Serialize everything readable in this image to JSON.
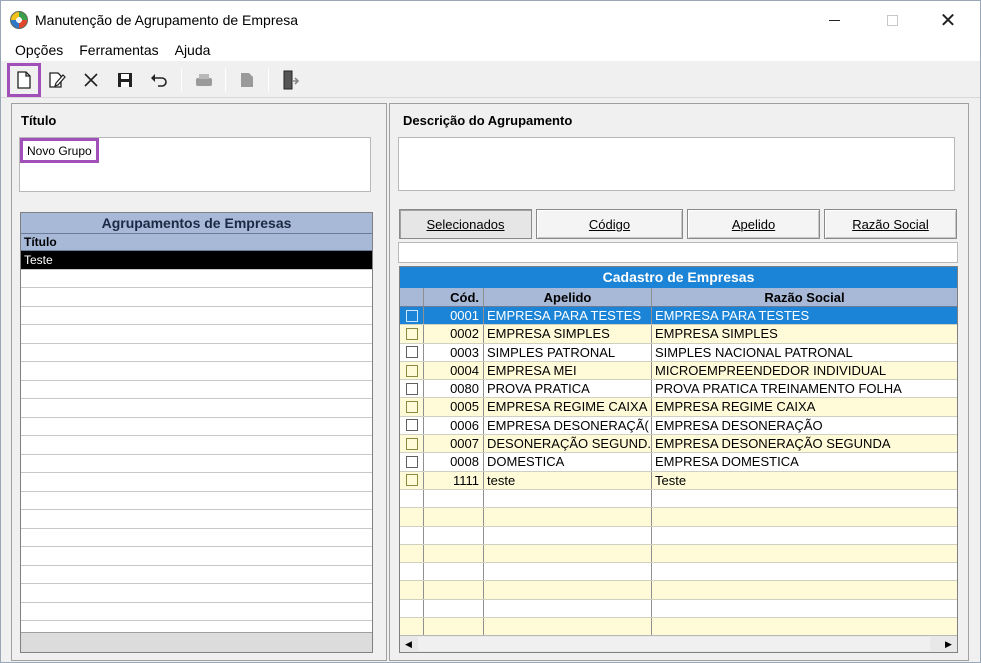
{
  "window": {
    "title": "Manutenção de Agrupamento de Empresa",
    "close_glyph": "✕"
  },
  "menu": [
    "Opções",
    "Ferramentas",
    "Ajuda"
  ],
  "toolbar": {
    "icons": [
      "new-document-icon",
      "edit-icon",
      "delete-icon",
      "save-icon",
      "undo-icon",
      "print-icon",
      "copy-icon",
      "exit-icon"
    ]
  },
  "left": {
    "titulo_label": "Título",
    "titulo_value": "Novo Grupo",
    "grid_title": "Agrupamentos de Empresas",
    "grid_column": "Título",
    "rows": [
      "Teste"
    ]
  },
  "right": {
    "descricao_label": "Descrição do Agrupamento",
    "descricao_value": "",
    "buttons": [
      "Selecionados",
      "Código",
      "Apelido",
      "Razão Social"
    ],
    "grid_title": "Cadastro de Empresas",
    "columns": [
      "",
      "Cód.",
      "Apelido",
      "Razão Social"
    ],
    "rows": [
      {
        "codigo": "0001",
        "apelido": "EMPRESA PARA TESTES",
        "razao": "EMPRESA PARA TESTES"
      },
      {
        "codigo": "0002",
        "apelido": "EMPRESA SIMPLES",
        "razao": "EMPRESA SIMPLES"
      },
      {
        "codigo": "0003",
        "apelido": "SIMPLES PATRONAL",
        "razao": "SIMPLES NACIONAL PATRONAL"
      },
      {
        "codigo": "0004",
        "apelido": "EMPRESA MEI",
        "razao": "MICROEMPREENDEDOR INDIVIDUAL"
      },
      {
        "codigo": "0080",
        "apelido": "PROVA PRATICA",
        "razao": "PROVA PRATICA TREINAMENTO FOLHA"
      },
      {
        "codigo": "0005",
        "apelido": "EMPRESA REGIME CAIXA",
        "razao": "EMPRESA REGIME CAIXA"
      },
      {
        "codigo": "0006",
        "apelido": "EMPRESA DESONERAÇÃ(",
        "razao": "EMPRESA DESONERAÇÃO"
      },
      {
        "codigo": "0007",
        "apelido": "DESONERAÇÃO SEGUND.",
        "razao": "EMPRESA DESONERAÇÃO SEGUNDA"
      },
      {
        "codigo": "0008",
        "apelido": "DOMESTICA",
        "razao": "EMPRESA DOMESTICA"
      },
      {
        "codigo": "1111",
        "apelido": "teste",
        "razao": "Teste"
      }
    ],
    "row_colors": {
      "selected": "#1b84d6",
      "alt": "#fffbd8",
      "plain": "#ffffff"
    }
  },
  "colors": {
    "accent": "#1b84d6",
    "header": "#a7b9d6",
    "highlight": "#a050b8"
  }
}
